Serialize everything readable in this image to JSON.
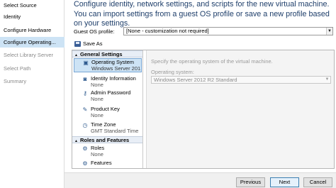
{
  "nav": {
    "items": [
      {
        "label": "Select Source",
        "state": "normal"
      },
      {
        "label": "Identity",
        "state": "normal"
      },
      {
        "label": "Configure Hardware",
        "state": "normal"
      },
      {
        "label": "Configure Operating...",
        "state": "active"
      },
      {
        "label": "Select Library Server",
        "state": "disabled"
      },
      {
        "label": "Select Path",
        "state": "disabled"
      },
      {
        "label": "Summary",
        "state": "disabled"
      }
    ]
  },
  "header": {
    "text": "Configure identity, network settings, and scripts for the new virtual machine. You can import settings from a guest OS profile or save a new profile based on your settings."
  },
  "guest_os": {
    "label": "Guest OS profile:",
    "value": "[None - customization not required]"
  },
  "toolbar": {
    "save_as_label": "Save As"
  },
  "settings": {
    "group_general": "General Settings",
    "group_roles": "Roles and Features",
    "items": [
      {
        "name": "Operating System",
        "value": "Windows Server 201...",
        "icon": "computer-icon"
      },
      {
        "name": "Identity Information",
        "value": "None",
        "icon": "id-card-icon"
      },
      {
        "name": "Admin Password",
        "value": "None",
        "icon": "key-icon"
      },
      {
        "name": "Product Key",
        "value": "None",
        "icon": "product-key-icon"
      },
      {
        "name": "Time Zone",
        "value": "GMT Standard Time",
        "icon": "clock-icon"
      },
      {
        "name": "Roles",
        "value": "None",
        "icon": "roles-icon"
      },
      {
        "name": "Features",
        "value": "",
        "icon": "features-icon"
      }
    ]
  },
  "detail": {
    "description": "Specify the operating system of the virtual machine.",
    "os_label": "Operating system:",
    "os_value": "Windows Server 2012 R2 Standard"
  },
  "footer": {
    "previous_label": "Previous",
    "next_label": "Next",
    "cancel_label": "Cancel"
  },
  "colors": {
    "selection": "#cde3f5",
    "header_text": "#1e3e6a"
  }
}
